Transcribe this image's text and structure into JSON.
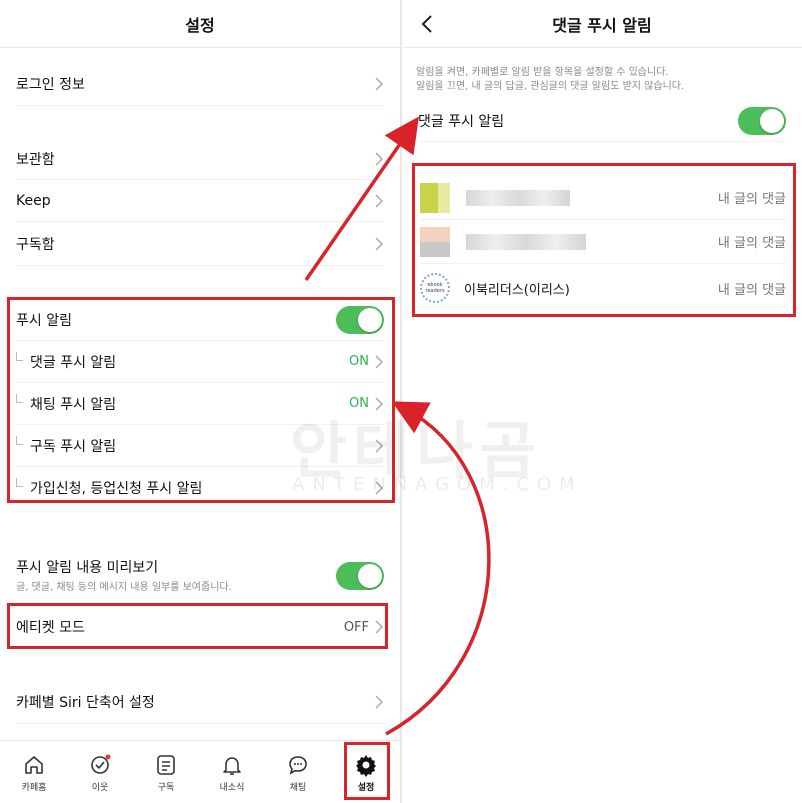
{
  "left": {
    "title": "설정",
    "login_info": "로그인 정보",
    "storage": "보관함",
    "keep": "Keep",
    "subscriptions": "구독함",
    "push": {
      "label": "푸시 알림",
      "items": [
        {
          "label": "댓글 푸시 알림",
          "value": "ON"
        },
        {
          "label": "채팅 푸시 알림",
          "value": "ON"
        },
        {
          "label": "구독 푸시 알림",
          "value": ""
        },
        {
          "label": "가입신청, 등업신청 푸시 알림",
          "value": ""
        }
      ]
    },
    "preview": {
      "label": "푸시 알림 내용 미리보기",
      "hint": "글, 댓글, 채팅 등의 메시지 내용 일부를 보여줍니다."
    },
    "etiquette": {
      "label": "에티켓 모드",
      "value": "OFF"
    },
    "siri": "카페별 Siri 단축어 설정"
  },
  "tabs": [
    {
      "label": "카페홈",
      "icon": "home-icon"
    },
    {
      "label": "이웃",
      "icon": "heart-icon"
    },
    {
      "label": "구독",
      "icon": "list-icon"
    },
    {
      "label": "내소식",
      "icon": "bell-icon"
    },
    {
      "label": "채팅",
      "icon": "chat-icon"
    },
    {
      "label": "설정",
      "icon": "gear-icon"
    }
  ],
  "right": {
    "title": "댓글 푸시 알림",
    "hint_line1": "알림을 켜면, 카페별로 알림 받을 항목을 설정할 수 있습니다.",
    "hint_line2": "알림을 끄면, 내 글의 답글, 관심글의 댓글 알림도 받지 않습니다.",
    "toggle_label": "댓글 푸시 알림",
    "cafes": [
      {
        "name": "",
        "tag": "내 글의 댓글"
      },
      {
        "name": "",
        "tag": "내 글의 댓글"
      },
      {
        "name": "이북리더스(이리스)",
        "tag": "내 글의 댓글",
        "logo_text": "ebook readers"
      }
    ]
  },
  "watermark": {
    "main": "안테나곰",
    "sub": "ANTENNAGOM.COM"
  },
  "colors": {
    "toggle_on": "#4cbd5b",
    "highlight": "#d8232a",
    "on_text": "#2eb34a"
  }
}
